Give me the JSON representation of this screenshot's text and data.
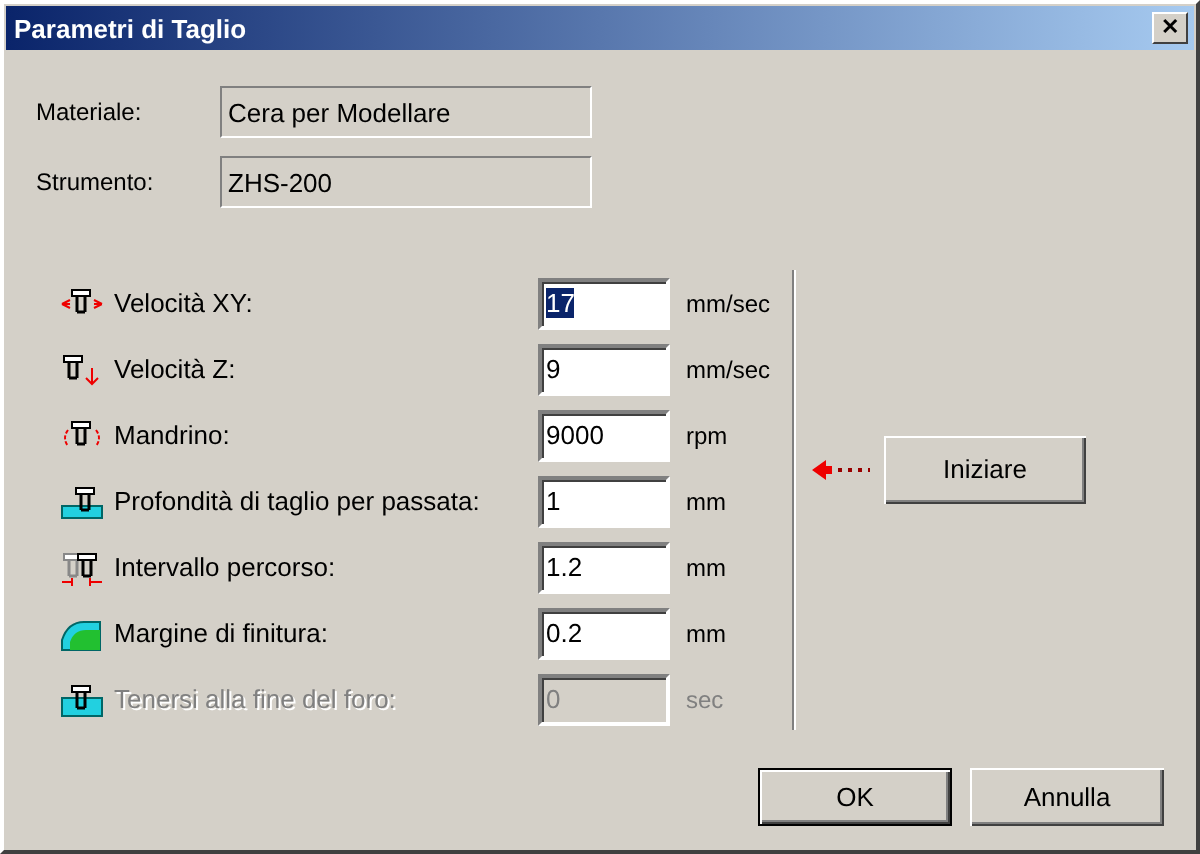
{
  "window": {
    "title": "Parametri di Taglio",
    "close": "✕"
  },
  "info": [
    {
      "label": "Materiale:",
      "value": "Cera per Modellare"
    },
    {
      "label": "Strumento:",
      "value": "ZHS-200"
    }
  ],
  "params": [
    {
      "kind": "xy",
      "label": "Velocità XY:",
      "value": "17",
      "unit": "mm/sec",
      "selected": true,
      "disabled": false
    },
    {
      "kind": "z",
      "label": "Velocità Z:",
      "value": "9",
      "unit": "mm/sec",
      "selected": false,
      "disabled": false
    },
    {
      "kind": "spindle",
      "label": "Mandrino:",
      "value": "9000",
      "unit": "rpm",
      "selected": false,
      "disabled": false
    },
    {
      "kind": "depth",
      "label": "Profondità di taglio per passata:",
      "value": "1",
      "unit": "mm",
      "selected": false,
      "disabled": false
    },
    {
      "kind": "stepover",
      "label": "Intervallo percorso:",
      "value": "1.2",
      "unit": "mm",
      "selected": false,
      "disabled": false
    },
    {
      "kind": "finish",
      "label": "Margine di finitura:",
      "value": "0.2",
      "unit": "mm",
      "selected": false,
      "disabled": false
    },
    {
      "kind": "dwell",
      "label": "Tenersi alla fine del foro:",
      "value": "0",
      "unit": "sec",
      "selected": false,
      "disabled": true
    }
  ],
  "start_button": "Iniziare",
  "buttons": [
    {
      "label": "OK",
      "default": true
    },
    {
      "label": "Annulla",
      "default": false
    }
  ]
}
